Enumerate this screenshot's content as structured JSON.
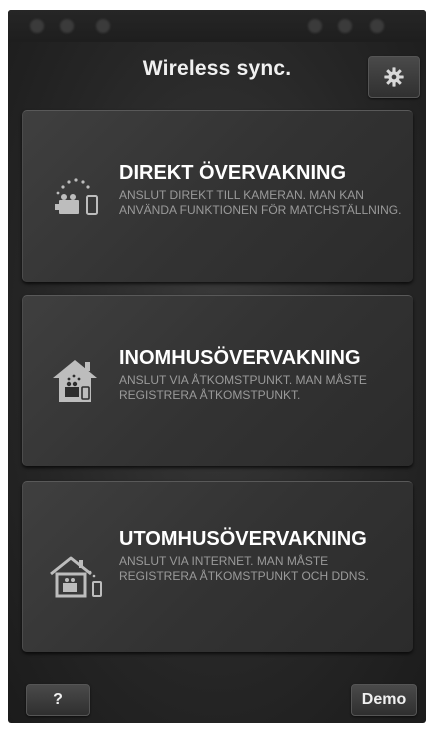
{
  "header": {
    "title": "Wireless sync.",
    "settings_icon": "gear-icon"
  },
  "options": [
    {
      "title": "DIREKT ÖVERVAKNING",
      "description": "ANSLUT DIREKT TILL KAMERAN. MAN KAN ANVÄNDA FUNKTIONEN FÖR MATCHSTÄLLNING.",
      "icon": "direct-connection-icon"
    },
    {
      "title": "INOMHUSÖVERVAKNING",
      "description": "ANSLUT VIA ÅTKOMSTPUNKT. MAN MÅSTE REGISTRERA ÅTKOMSTPUNKT.",
      "icon": "indoor-house-icon"
    },
    {
      "title": "UTOMHUSÖVERVAKNING",
      "description": "ANSLUT VIA INTERNET. MAN MÅSTE REGISTRERA ÅTKOMSTPUNKT OCH DDNS.",
      "icon": "outdoor-house-icon"
    }
  ],
  "footer": {
    "help_label": "?",
    "demo_label": "Demo"
  },
  "colors": {
    "background": "#262626",
    "card": "#363636",
    "title_text": "#ffffff",
    "description_text": "#9a9a9a"
  }
}
